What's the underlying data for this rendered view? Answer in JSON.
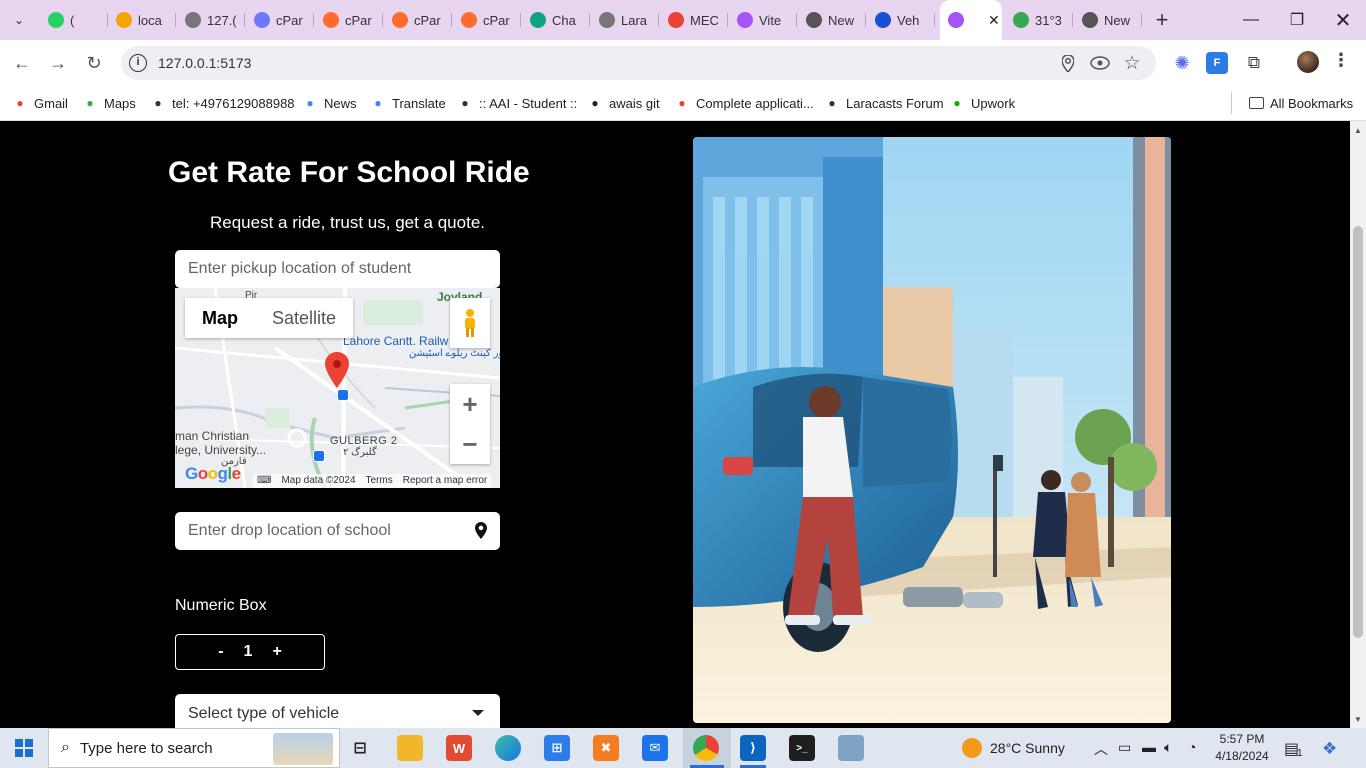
{
  "browser": {
    "tabs": [
      {
        "label": "(",
        "favicon": "whatsapp-icon",
        "color": "#25d366"
      },
      {
        "label": "loca",
        "favicon": "phpmyadmin-icon",
        "color": "#f4a300"
      },
      {
        "label": "127.(",
        "favicon": "globe-icon",
        "color": "#777777"
      },
      {
        "label": "cPar",
        "favicon": "chatgpt-icon",
        "color": "#6e78ff"
      },
      {
        "label": "cPar",
        "favicon": "cpanel-icon",
        "color": "#ff6c2c"
      },
      {
        "label": "cPar",
        "favicon": "cpanel-icon",
        "color": "#ff6c2c"
      },
      {
        "label": "cPar",
        "favicon": "cpanel-icon",
        "color": "#ff6c2c"
      },
      {
        "label": "Cha",
        "favicon": "chatgpt-icon",
        "color": "#10a37f"
      },
      {
        "label": "Lara",
        "favicon": "globe-icon",
        "color": "#777777"
      },
      {
        "label": "MEC",
        "favicon": "maps-pin-icon",
        "color": "#ea4335"
      },
      {
        "label": "Vite",
        "favicon": "vite-icon",
        "color": "#a855f7"
      },
      {
        "label": "New",
        "favicon": "globe-icon",
        "color": "#555555"
      },
      {
        "label": "Veh",
        "favicon": "shield-icon",
        "color": "#1a4fd0"
      },
      {
        "label": "",
        "favicon": "vite-icon",
        "color": "#a855f7",
        "active": true
      },
      {
        "label": "31°3",
        "favicon": "maps-pin-icon",
        "color": "#34a853"
      },
      {
        "label": "New",
        "favicon": "globe-icon",
        "color": "#555555"
      }
    ],
    "url": "127.0.0.1:5173",
    "bookmarks": [
      {
        "label": "Gmail",
        "icon": "gmail-icon",
        "color": "#ea4335"
      },
      {
        "label": "Maps",
        "icon": "maps-icon",
        "color": "#34a853"
      },
      {
        "label": "tel: +4976129088988",
        "icon": "globe-icon",
        "color": "#333333"
      },
      {
        "label": "News",
        "icon": "news-icon",
        "color": "#4285f4"
      },
      {
        "label": "Translate",
        "icon": "translate-icon",
        "color": "#4285f4"
      },
      {
        "label": ":: AAI - Student ::",
        "icon": "globe-icon",
        "color": "#333333"
      },
      {
        "label": "awais git",
        "icon": "github-icon",
        "color": "#222222"
      },
      {
        "label": "Complete applicati...",
        "icon": "google-icon",
        "color": "#ea4335"
      },
      {
        "label": "Laracasts Forum",
        "icon": "laracasts-icon",
        "color": "#333333"
      },
      {
        "label": "Upwork",
        "icon": "upwork-icon",
        "color": "#14a800"
      }
    ],
    "all_bookmarks": "All Bookmarks"
  },
  "page": {
    "title": "Get Rate For School Ride",
    "subtitle": "Request a ride, trust us, get a quote.",
    "pickup": {
      "placeholder": "Enter pickup location of student"
    },
    "drop": {
      "placeholder": "Enter drop location of school"
    },
    "map": {
      "type_map": "Map",
      "type_satellite": "Satellite",
      "labels": {
        "station": "Lahore Cantt. Railw",
        "station_urdu": "لاہور کینٹ ریلوے اسٹیشن",
        "joyland": "Joyland",
        "gulberg": "GULBERG 2",
        "gulberg_urdu": "گلبرگ ۲",
        "christian": "man Christian",
        "college": "lege, University...",
        "college_urdu": "فارمن",
        "pir": "Pir"
      },
      "map_data": "Map data ©2024",
      "terms": "Terms",
      "report": "Report a map error"
    },
    "numeric_label": "Numeric Box",
    "stepper": {
      "minus": "-",
      "value": "1",
      "plus": "+"
    },
    "vehicle_select": "Select type of vehicle"
  },
  "taskbar": {
    "search_placeholder": "Type here to search",
    "weather": "28°C  Sunny",
    "time": "5:57 PM",
    "date": "4/18/2024",
    "notification_count": "1"
  },
  "colors": {
    "tabstrip": "#e8d5f0",
    "page_bg": "#000000",
    "accent": "#2a6fd6"
  }
}
